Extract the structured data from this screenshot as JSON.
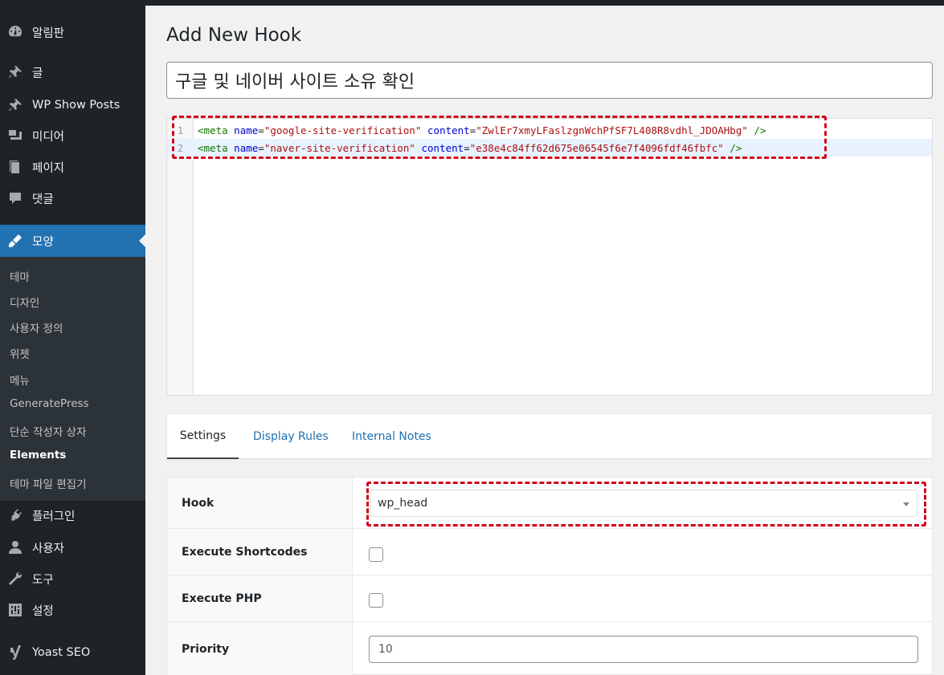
{
  "sidebar": {
    "items": [
      {
        "label": "알림판",
        "icon": "dashboard-icon"
      },
      {
        "label": "글",
        "icon": "pin-icon"
      },
      {
        "label": "WP Show Posts",
        "icon": "pin-icon"
      },
      {
        "label": "미디어",
        "icon": "media-icon"
      },
      {
        "label": "페이지",
        "icon": "pages-icon"
      },
      {
        "label": "댓글",
        "icon": "comments-icon"
      },
      {
        "label": "모양",
        "icon": "appearance-icon"
      },
      {
        "label": "플러그인",
        "icon": "plugins-icon"
      },
      {
        "label": "사용자",
        "icon": "users-icon"
      },
      {
        "label": "도구",
        "icon": "tools-icon"
      },
      {
        "label": "설정",
        "icon": "settings-icon"
      },
      {
        "label": "Yoast SEO",
        "icon": "yoast-icon"
      }
    ],
    "submenu": [
      "테마",
      "디자인",
      "사용자 정의",
      "위젯",
      "메뉴",
      "GeneratePress",
      "단순 작성자 상자",
      "Elements",
      "테마 파일 편집기"
    ]
  },
  "page": {
    "title": "Add New Hook",
    "hook_title": "구글 및 네이버 사이트 소유 확인"
  },
  "editor": {
    "lines": [
      {
        "number": "1",
        "tag_open": "<meta",
        "attr1": "name",
        "val1": "\"google-site-verification\"",
        "attr2": "content",
        "val2": "\"ZwlEr7xmyLFaslzgnWchPfSF7L408R8vdhl_JDOAHbg\"",
        "tag_close": "/>"
      },
      {
        "number": "2",
        "tag_open": "<meta",
        "attr1": "name",
        "val1": "\"naver-site-verification\"",
        "attr2": "content",
        "val2": "\"e38e4c84ff62d675e06545f6e7f4096fdf46fbfc\"",
        "tag_close": "/>"
      }
    ]
  },
  "tabs": [
    {
      "label": "Settings",
      "active": true
    },
    {
      "label": "Display Rules",
      "active": false
    },
    {
      "label": "Internal Notes",
      "active": false
    }
  ],
  "settings": {
    "hook_label": "Hook",
    "hook_value": "wp_head",
    "shortcodes_label": "Execute Shortcodes",
    "php_label": "Execute PHP",
    "priority_label": "Priority",
    "priority_value": "10"
  },
  "colors": {
    "sidebar_bg": "#1d2327",
    "accent": "#2271b1",
    "highlight_box": "#d0021b"
  }
}
